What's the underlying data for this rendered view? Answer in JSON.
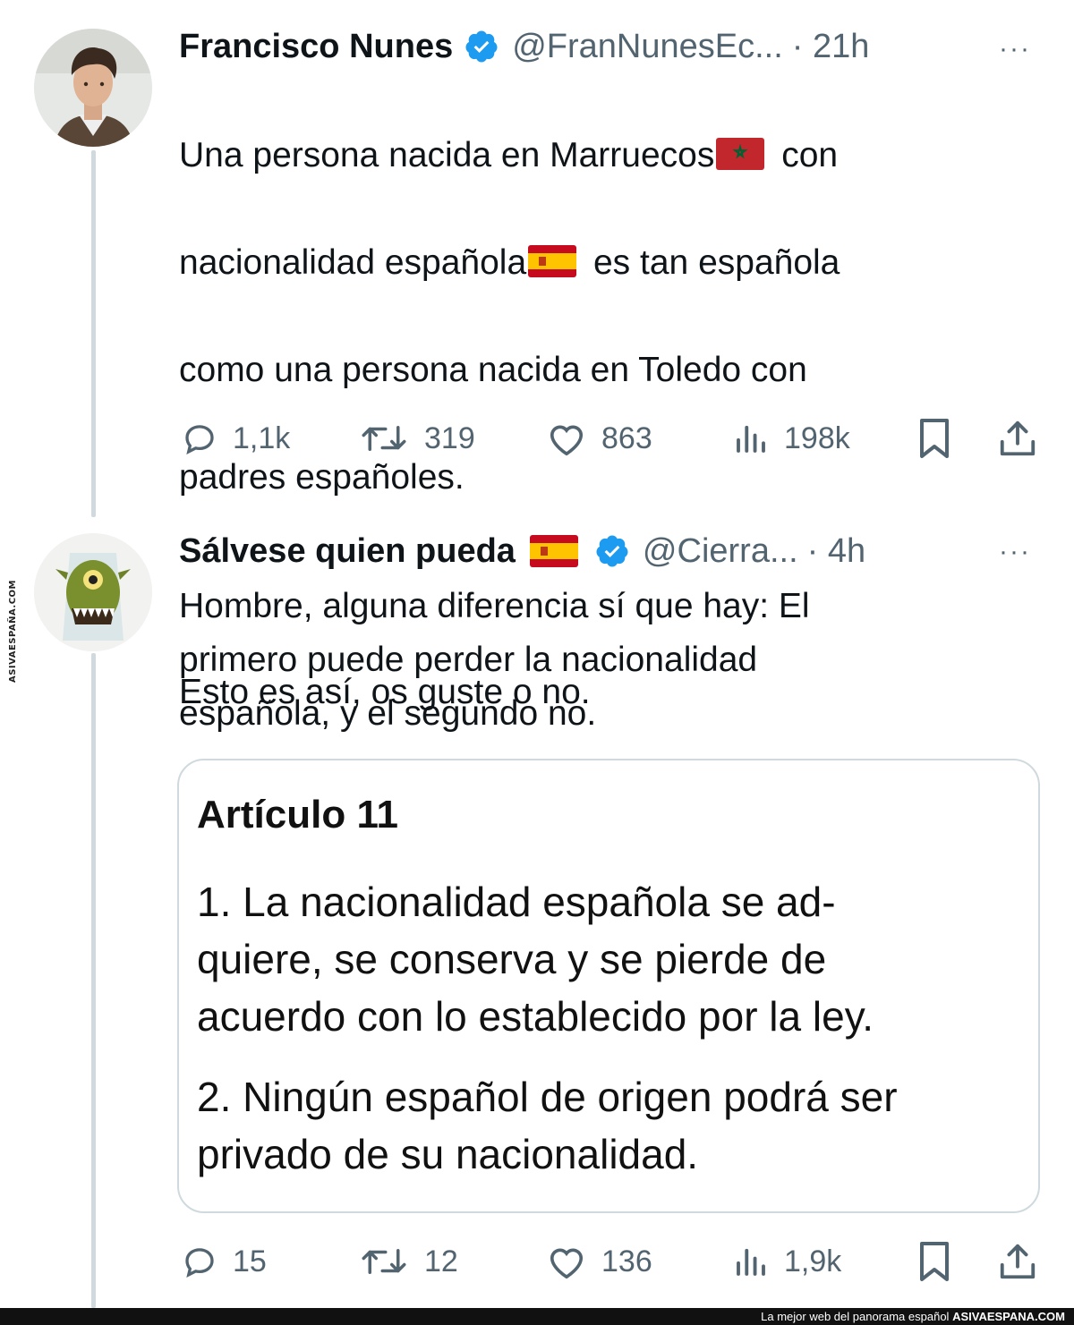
{
  "watermark": {
    "side_text": "ASIVAESPAÑA.COM"
  },
  "tweet1": {
    "name": "Francisco Nunes",
    "handle": "@FranNunesEc...",
    "time": "· 21h",
    "more": "···",
    "text_l1a": "Una persona nacida en Marruecos",
    "text_l1b": " con",
    "text_l2a": "nacionalidad española",
    "text_l2b": " es tan española",
    "text_l3": "como una persona nacida en Toledo con",
    "text_l4": "padres españoles.",
    "text_l5": "Esto es así, os guste o no.",
    "replies": "1,1k",
    "retweets": "319",
    "likes": "863",
    "views": "198k",
    "avatar_icon": "person-portrait"
  },
  "tweet2": {
    "name": "Sálvese quien pueda",
    "handle": "@Cierra...",
    "time": "· 4h",
    "more": "···",
    "text": "Hombre, alguna diferencia sí que hay: El\nprimero puede perder la nacionalidad\nespañola, y el segundo no.",
    "replies": "15",
    "retweets": "12",
    "likes": "136",
    "views": "1,9k",
    "avatar_icon": "green-monster"
  },
  "card": {
    "title": "Artículo 11",
    "p1": "1. La nacionalidad española se ad-\nquiere, se conserva y se pierde de\nacuerdo con lo establecido por la ley.",
    "p2": "2. Ningún español de origen podrá ser\nprivado de su nacionalidad."
  },
  "footer": {
    "tagline": "La mejor web del panorama español",
    "brand": "ASIVAESPANA.COM"
  },
  "colors": {
    "text": "#0f1419",
    "muted": "#536471",
    "verified": "#1d9bf0",
    "thread_line": "#cfd9de",
    "flag_red": "#c1272d",
    "flag_yellow": "#ffc400"
  }
}
